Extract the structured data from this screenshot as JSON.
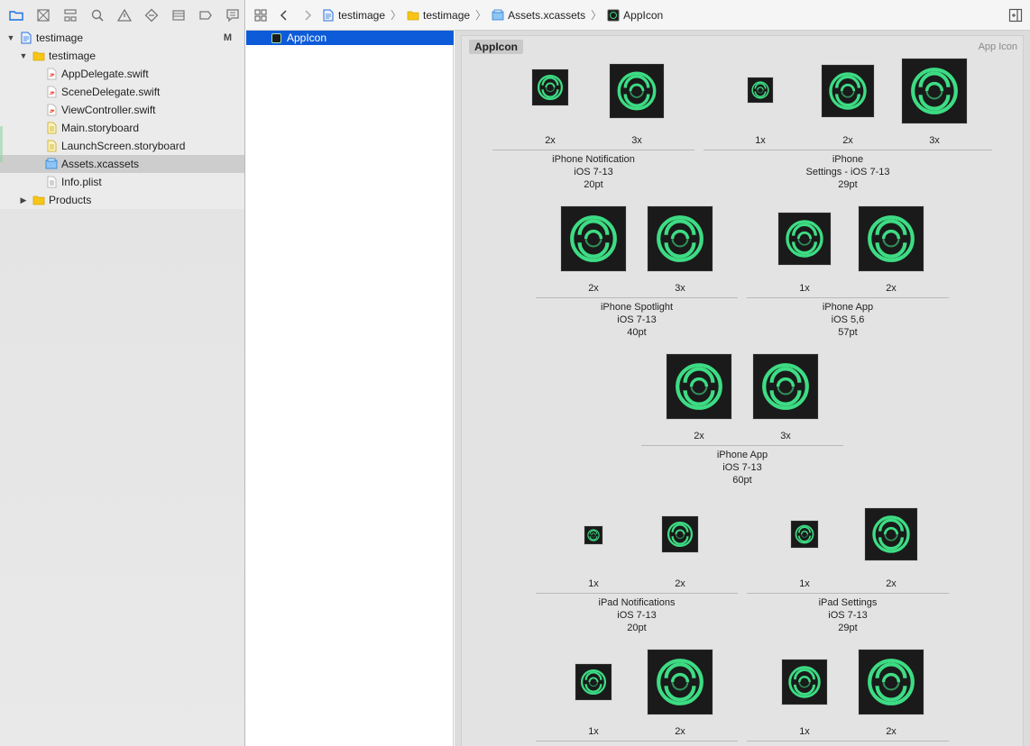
{
  "navigator": {
    "tree": [
      {
        "label": "testimage",
        "level": 0,
        "kind": "project",
        "expanded": true,
        "badge": "M"
      },
      {
        "label": "testimage",
        "level": 1,
        "kind": "folder",
        "expanded": true
      },
      {
        "label": "AppDelegate.swift",
        "level": 2,
        "kind": "swift"
      },
      {
        "label": "SceneDelegate.swift",
        "level": 2,
        "kind": "swift"
      },
      {
        "label": "ViewController.swift",
        "level": 2,
        "kind": "swift"
      },
      {
        "label": "Main.storyboard",
        "level": 2,
        "kind": "storyboard"
      },
      {
        "label": "LaunchScreen.storyboard",
        "level": 2,
        "kind": "storyboard"
      },
      {
        "label": "Assets.xcassets",
        "level": 2,
        "kind": "assets",
        "selected": true
      },
      {
        "label": "Info.plist",
        "level": 2,
        "kind": "plist"
      },
      {
        "label": "Products",
        "level": 1,
        "kind": "folder",
        "expanded": false
      }
    ]
  },
  "jumpbar": {
    "crumbs": [
      {
        "label": "testimage",
        "icon": "project-icon"
      },
      {
        "label": "testimage",
        "icon": "folder-icon"
      },
      {
        "label": "Assets.xcassets",
        "icon": "assets-icon"
      },
      {
        "label": "AppIcon",
        "icon": "appicon-icon"
      }
    ]
  },
  "asset_list": {
    "selected": "AppIcon"
  },
  "editor": {
    "set_name": "AppIcon",
    "set_type": "App Icon",
    "groups": [
      {
        "title": "iPhone Notification",
        "sub": "iOS 7-13",
        "size": "20pt",
        "scales": [
          "2x",
          "3x"
        ]
      },
      {
        "title": "iPhone",
        "sub": "Settings - iOS 7-13",
        "size": "29pt",
        "scales": [
          "1x",
          "2x",
          "3x"
        ]
      },
      {
        "title": "iPhone Spotlight",
        "sub": "iOS 7-13",
        "size": "40pt",
        "scales": [
          "2x",
          "3x"
        ]
      },
      {
        "title": "iPhone App",
        "sub": "iOS 5,6",
        "size": "57pt",
        "scales": [
          "1x",
          "2x"
        ]
      },
      {
        "title": "iPhone App",
        "sub": "iOS 7-13",
        "size": "60pt",
        "scales": [
          "2x",
          "3x"
        ]
      },
      {
        "title": "iPad Notifications",
        "sub": "iOS 7-13",
        "size": "20pt",
        "scales": [
          "1x",
          "2x"
        ]
      },
      {
        "title": "iPad Settings",
        "sub": "iOS 7-13",
        "size": "29pt",
        "scales": [
          "1x",
          "2x"
        ]
      },
      {
        "title": "",
        "sub": "",
        "size": "",
        "scales": [
          "1x",
          "2x"
        ]
      },
      {
        "title": "",
        "sub": "",
        "size": "",
        "scales": [
          "1x",
          "2x"
        ]
      }
    ]
  },
  "colors": {
    "selection": "#0d5bd8",
    "icon_bg": "#1a1a1a",
    "icon_green": "#3ddc84"
  }
}
